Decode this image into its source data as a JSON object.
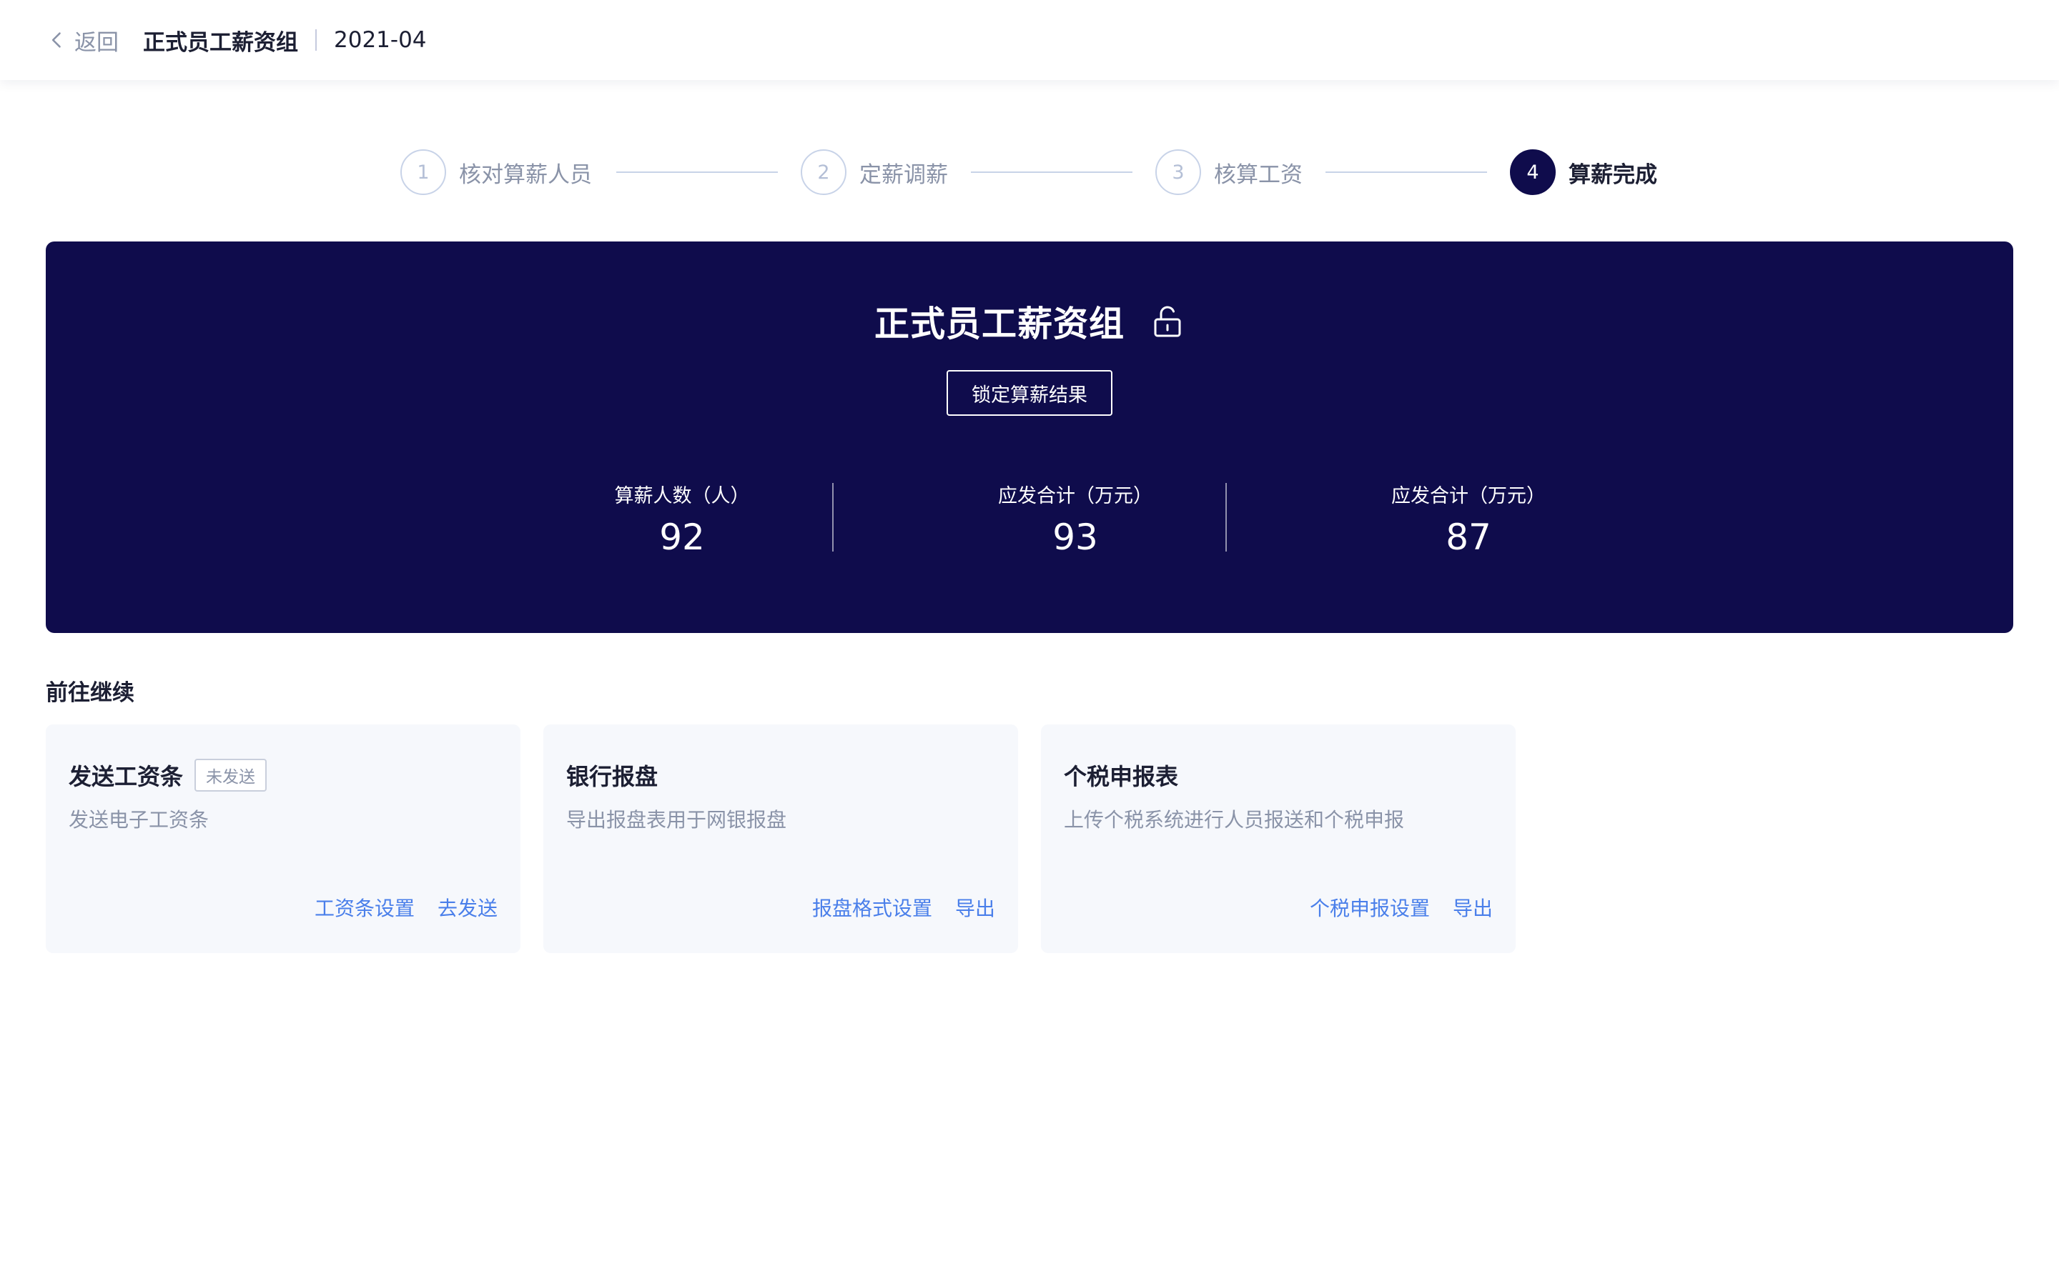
{
  "header": {
    "back_label": "返回",
    "title": "正式员工薪资组",
    "period": "2021-04"
  },
  "steps": [
    {
      "number": "1",
      "label": "核对算薪人员",
      "state": "done"
    },
    {
      "number": "2",
      "label": "定薪调薪",
      "state": "done"
    },
    {
      "number": "3",
      "label": "核算工资",
      "state": "done"
    },
    {
      "number": "4",
      "label": "算薪完成",
      "state": "active"
    }
  ],
  "summary": {
    "title": "正式员工薪资组",
    "lock_icon": "unlock-icon",
    "lock_button_label": "锁定算薪结果",
    "stats": [
      {
        "label": "算薪人数（人）",
        "value": "92"
      },
      {
        "label": "应发合计（万元）",
        "value": "93"
      },
      {
        "label": "应发合计（万元）",
        "value": "87"
      }
    ]
  },
  "continue_section": {
    "title": "前往继续",
    "cards": [
      {
        "title": "发送工资条",
        "badge": "未发送",
        "description": "发送电子工资条",
        "actions": [
          "工资条设置",
          "去发送"
        ]
      },
      {
        "title": "银行报盘",
        "description": "导出报盘表用于网银报盘",
        "actions": [
          "报盘格式设置",
          "导出"
        ]
      },
      {
        "title": "个税申报表",
        "description": "上传个税系统进行人员报送和个税申报",
        "actions": [
          "个税申报设置",
          "导出"
        ]
      }
    ]
  },
  "colors": {
    "banner_bg": "#0f0c4c",
    "link": "#4a7fea",
    "muted_text": "#8a93a8",
    "step_inactive": "#c8d3e8"
  }
}
